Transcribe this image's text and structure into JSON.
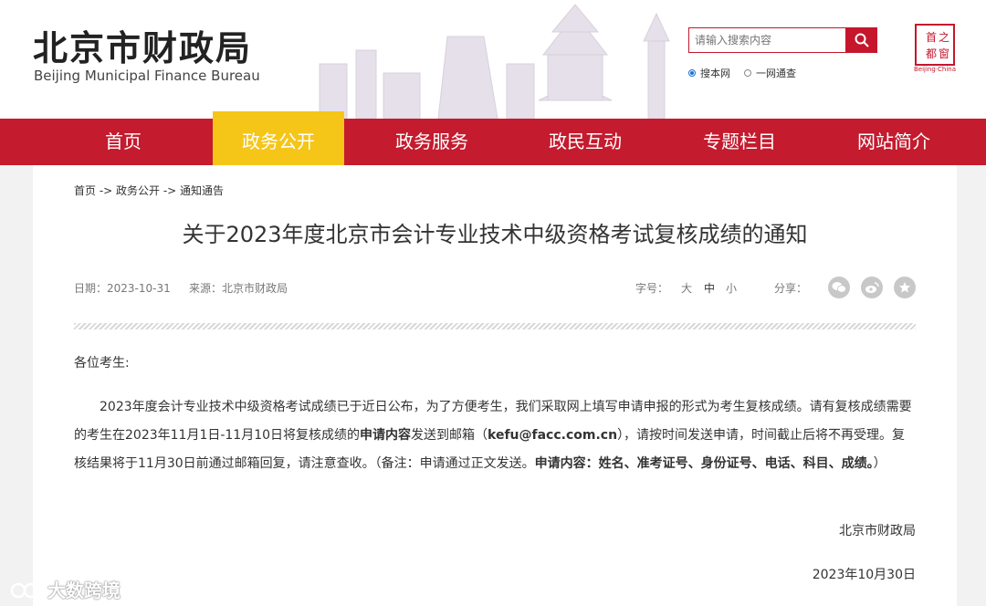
{
  "header": {
    "logo_cn": "北京市财政局",
    "logo_en": "Beijing Municipal Finance Bureau",
    "search_placeholder": "请输入搜索内容",
    "radio_site": "搜本网",
    "radio_all": "一网通查",
    "seal_caption": "Beijing·China"
  },
  "nav": [
    {
      "label": "首页",
      "active": false
    },
    {
      "label": "政务公开",
      "active": true
    },
    {
      "label": "政务服务",
      "active": false
    },
    {
      "label": "政民互动",
      "active": false
    },
    {
      "label": "专题栏目",
      "active": false
    },
    {
      "label": "网站简介",
      "active": false
    }
  ],
  "breadcrumb": "首页 -> 政务公开 -> 通知通告",
  "article": {
    "title": "关于2023年度北京市会计专业技术中级资格考试复核成绩的通知",
    "date_label": "日期：",
    "date": "2023-10-31",
    "source_label": "来源：",
    "source": "北京市财政局",
    "fontsize_label": "字号：",
    "font_large": "大",
    "font_medium": "中",
    "font_small": "小",
    "share_label": "分享：",
    "greeting": "各位考生:",
    "p1": "2023年度会计专业技术中级资格考试成绩已于近日公布，为了方便考生，我们采取网上填写申请申报的形式为考生复核成绩。请有复核成绩需要的考生在2023年11月1日-11月10日将复核成绩的",
    "b1": "申请内容",
    "p2": "发送到邮箱（",
    "email": "kefu@facc.com.cn",
    "p3": "），请按时间发送申请，时间截止后将不再受理。复核结果将于11月30日前通过邮箱回复，请注意查收。（备注：申请通过正文发送。",
    "b2": "申请内容：姓名、准考证号、身份证号、电话、科目、成绩。",
    "p4": "）",
    "signature": "北京市财政局",
    "sign_date": "2023年10月30日"
  },
  "watermark": "大数跨境",
  "colors": {
    "brand_red": "#c41b2e",
    "active_tab": "#f5c518"
  }
}
